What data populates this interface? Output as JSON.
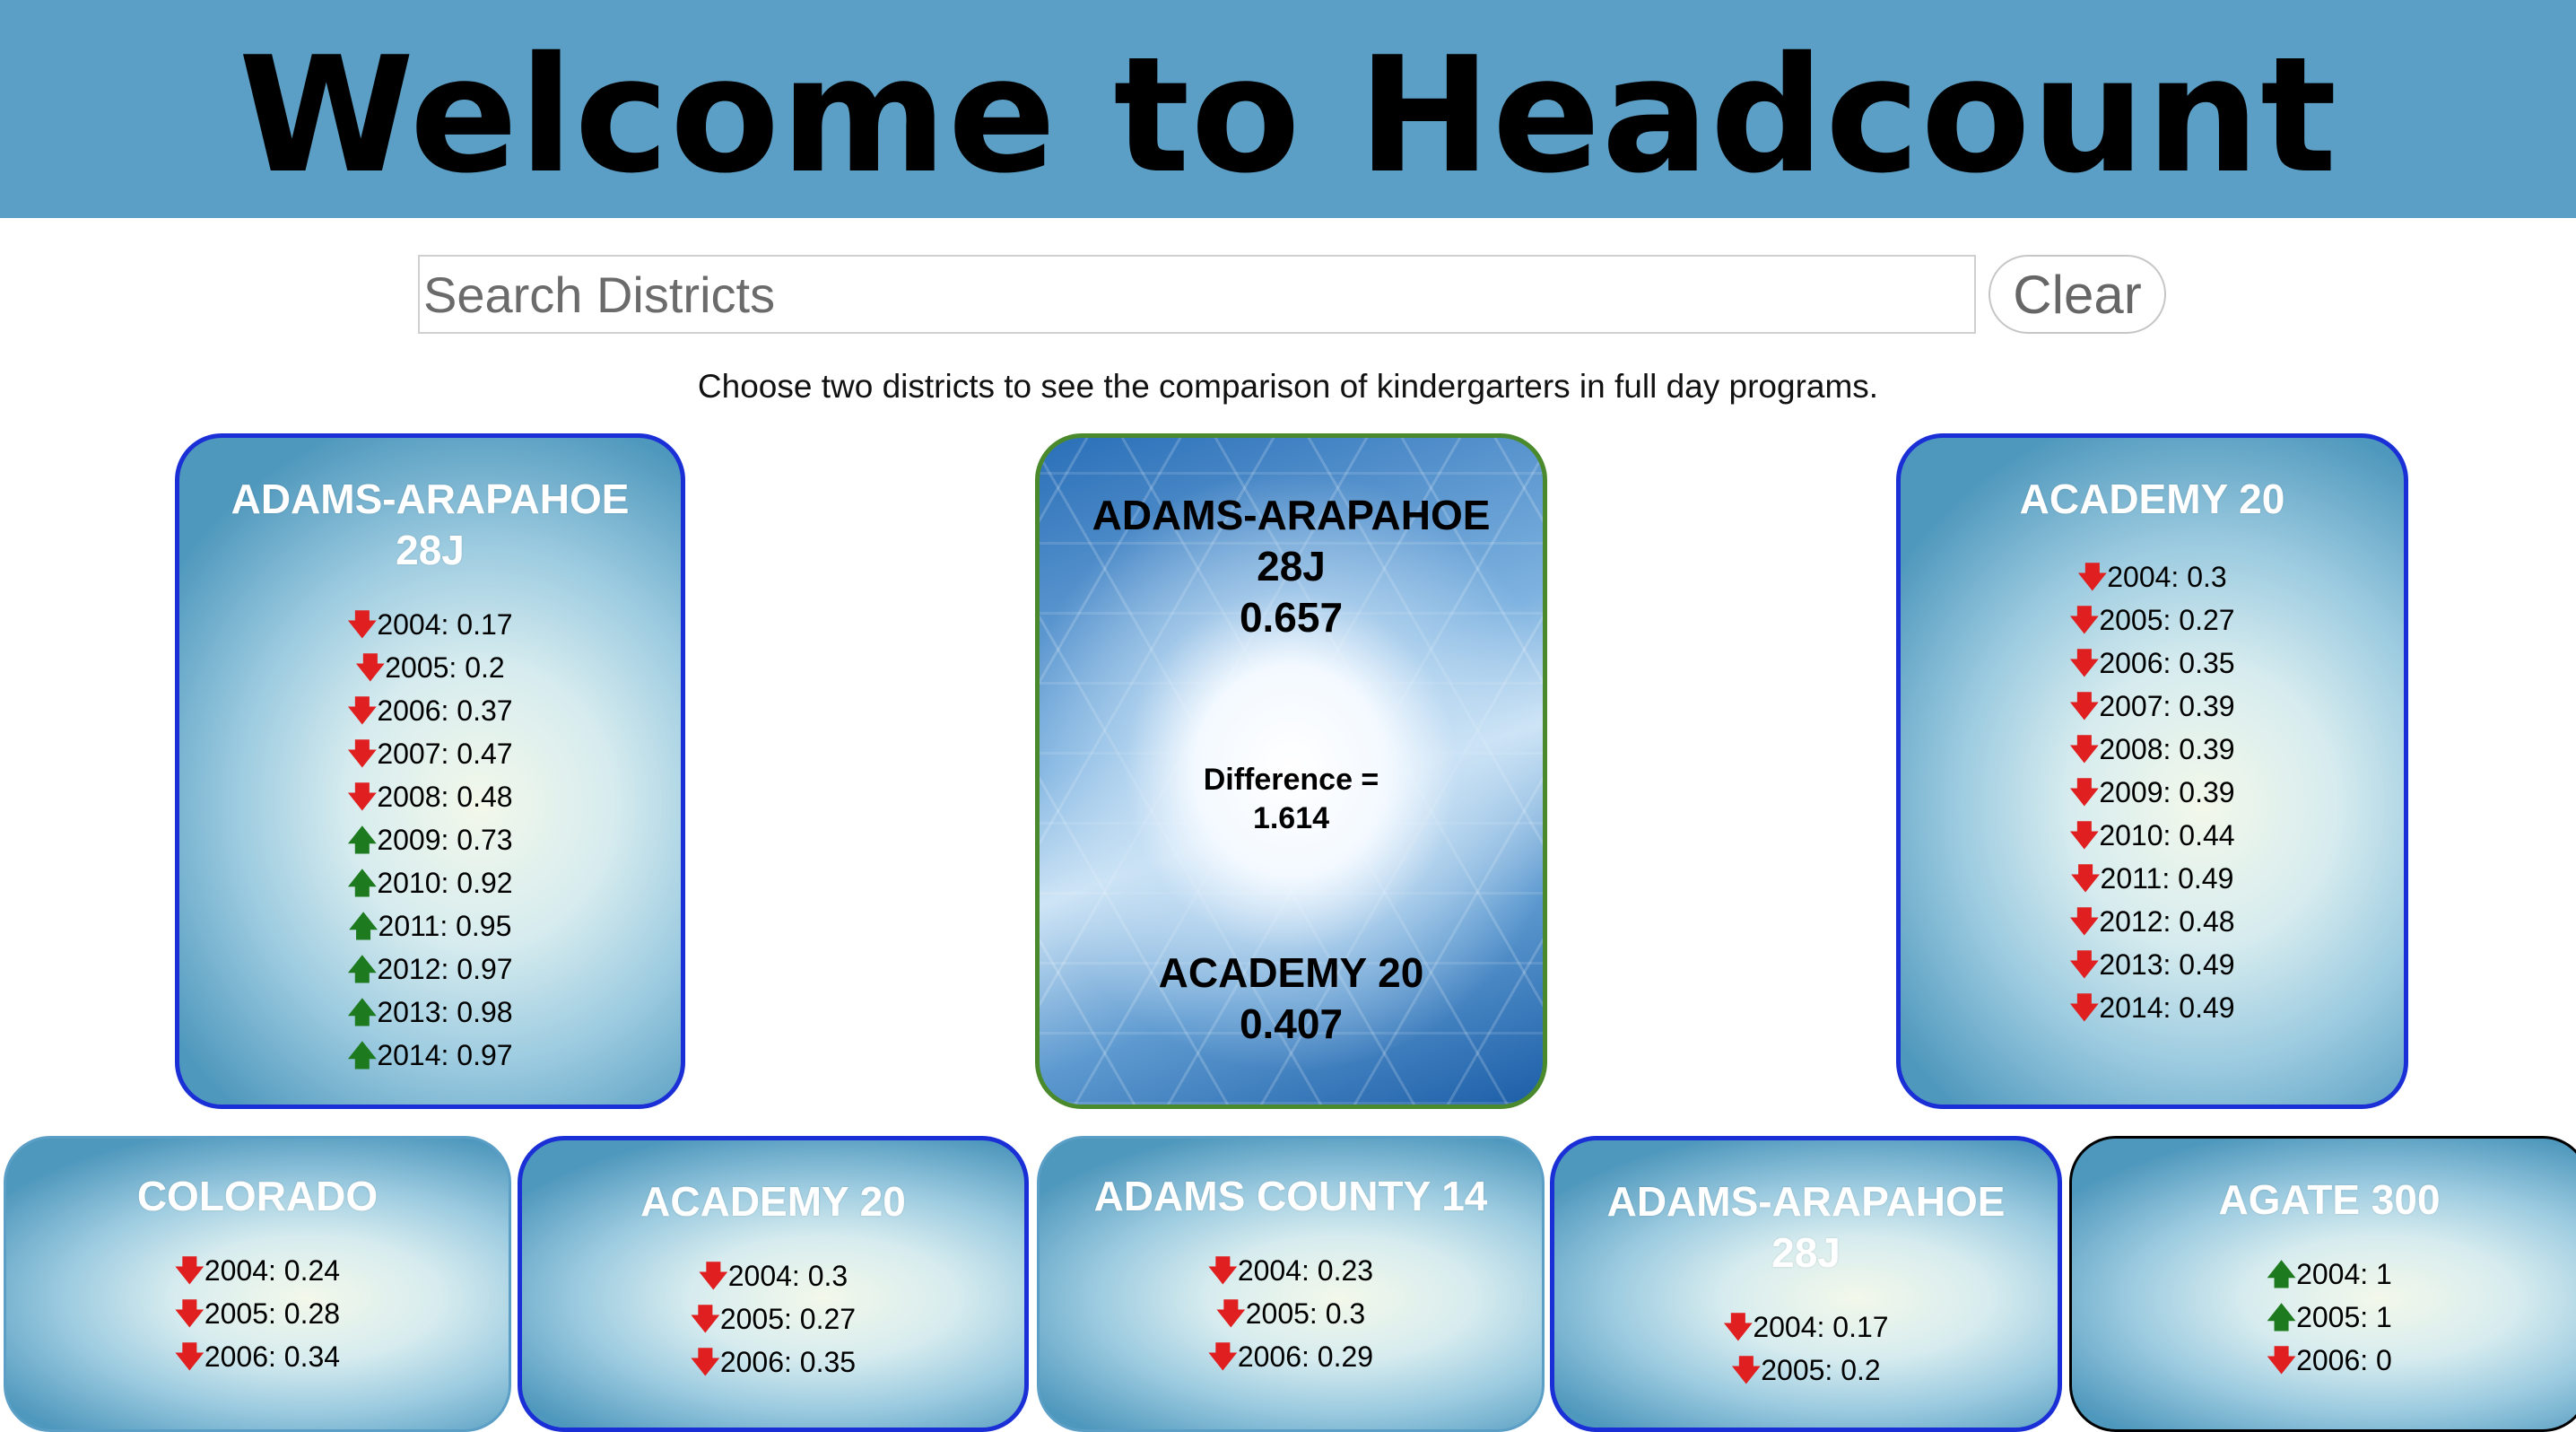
{
  "header": {
    "title": "Welcome to Headcount"
  },
  "search": {
    "placeholder": "Search Districts",
    "value": ""
  },
  "clear_label": "Clear",
  "instructions": "Choose two districts to see the comparison of kindergarters in full day programs.",
  "colors": {
    "header_bg": "#5b9fc6",
    "selected_border": "#1a2fd6",
    "compare_border": "#4a8a2c",
    "up_arrow": "#1e7a1e",
    "down_arrow": "#e02020"
  },
  "selected_cards": [
    {
      "name": "ADAMS-ARAPAHOE 28J",
      "years": [
        {
          "text": "2004: 0.17",
          "trend": "down"
        },
        {
          "text": "2005: 0.2",
          "trend": "down"
        },
        {
          "text": "2006: 0.37",
          "trend": "down"
        },
        {
          "text": "2007: 0.47",
          "trend": "down"
        },
        {
          "text": "2008: 0.48",
          "trend": "down"
        },
        {
          "text": "2009: 0.73",
          "trend": "up"
        },
        {
          "text": "2010: 0.92",
          "trend": "up"
        },
        {
          "text": "2011: 0.95",
          "trend": "up"
        },
        {
          "text": "2012: 0.97",
          "trend": "up"
        },
        {
          "text": "2013: 0.98",
          "trend": "up"
        },
        {
          "text": "2014: 0.97",
          "trend": "up"
        }
      ]
    },
    {
      "name": "ACADEMY 20",
      "years": [
        {
          "text": "2004: 0.3",
          "trend": "down"
        },
        {
          "text": "2005: 0.27",
          "trend": "down"
        },
        {
          "text": "2006: 0.35",
          "trend": "down"
        },
        {
          "text": "2007: 0.39",
          "trend": "down"
        },
        {
          "text": "2008: 0.39",
          "trend": "down"
        },
        {
          "text": "2009: 0.39",
          "trend": "down"
        },
        {
          "text": "2010: 0.44",
          "trend": "down"
        },
        {
          "text": "2011: 0.49",
          "trend": "down"
        },
        {
          "text": "2012: 0.48",
          "trend": "down"
        },
        {
          "text": "2013: 0.49",
          "trend": "down"
        },
        {
          "text": "2014: 0.49",
          "trend": "down"
        }
      ]
    }
  ],
  "comparison": {
    "district_a": {
      "name": "ADAMS-ARAPAHOE 28J",
      "value": "0.657"
    },
    "difference_label": "Difference =",
    "difference_value": "1.614",
    "district_b": {
      "name": "ACADEMY 20",
      "value": "0.407"
    }
  },
  "district_cards": [
    {
      "name": "COLORADO",
      "years": [
        {
          "text": "2004: 0.24",
          "trend": "down"
        },
        {
          "text": "2005: 0.28",
          "trend": "down"
        },
        {
          "text": "2006: 0.34",
          "trend": "down"
        }
      ]
    },
    {
      "name": "ACADEMY 20",
      "years": [
        {
          "text": "2004: 0.3",
          "trend": "down"
        },
        {
          "text": "2005: 0.27",
          "trend": "down"
        },
        {
          "text": "2006: 0.35",
          "trend": "down"
        }
      ]
    },
    {
      "name": "ADAMS COUNTY 14",
      "years": [
        {
          "text": "2004: 0.23",
          "trend": "down"
        },
        {
          "text": "2005: 0.3",
          "trend": "down"
        },
        {
          "text": "2006: 0.29",
          "trend": "down"
        }
      ]
    },
    {
      "name": "ADAMS-ARAPAHOE 28J",
      "years": [
        {
          "text": "2004: 0.17",
          "trend": "down"
        },
        {
          "text": "2005: 0.2",
          "trend": "down"
        }
      ]
    },
    {
      "name": "AGATE 300",
      "years": [
        {
          "text": "2004: 1",
          "trend": "up"
        },
        {
          "text": "2005: 1",
          "trend": "up"
        },
        {
          "text": "2006: 0",
          "trend": "down"
        }
      ]
    }
  ]
}
